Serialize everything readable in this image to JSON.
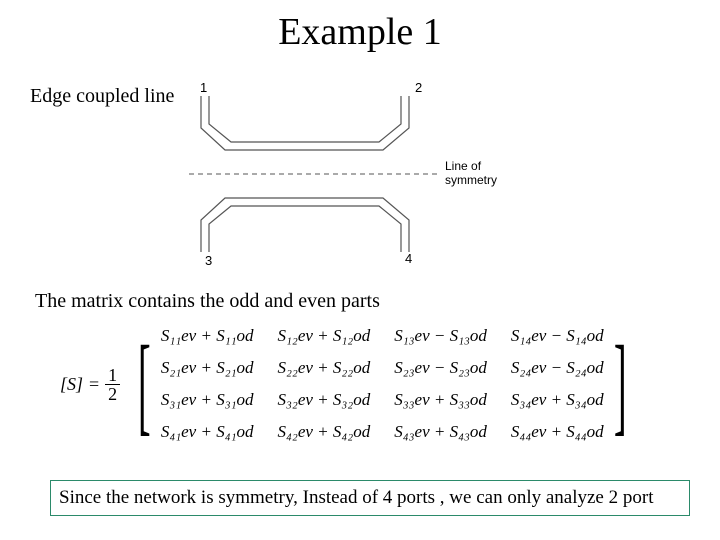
{
  "title": "Example 1",
  "subtitle_edge": "Edge coupled line",
  "diagram": {
    "port1": "1",
    "port2": "2",
    "port3": "3",
    "port4": "4",
    "los_label": "Line of\nsymmetry"
  },
  "subtitle_matrix": "The matrix contains the odd and even parts",
  "matrix": {
    "lhs": "[S]",
    "eq": "=",
    "frac_num": "1",
    "frac_den": "2",
    "cells": {
      "r1c1": "S₁₁ev + S₁₁od",
      "r1c2": "S₁₂ev + S₁₂od",
      "r1c3": "S₁₃ev − S₁₃od",
      "r1c4": "S₁₄ev − S₁₄od",
      "r2c1": "S₂₁ev + S₂₁od",
      "r2c2": "S₂₂ev + S₂₂od",
      "r2c3": "S₂₃ev − S₂₃od",
      "r2c4": "S₂₄ev − S₂₄od",
      "r3c1": "S₃₁ev + S₃₁od",
      "r3c2": "S₃₂ev + S₃₂od",
      "r3c3": "S₃₃ev + S₃₃od",
      "r3c4": "S₃₄ev + S₃₄od",
      "r4c1": "S₄₁ev + S₄₁od",
      "r4c2": "S₄₂ev + S₄₂od",
      "r4c3": "S₄₃ev + S₄₃od",
      "r4c4": "S₄₄ev + S₄₄od"
    }
  },
  "footer": "Since the network is symmetry, Instead of 4 ports , we can only analyze 2 port"
}
